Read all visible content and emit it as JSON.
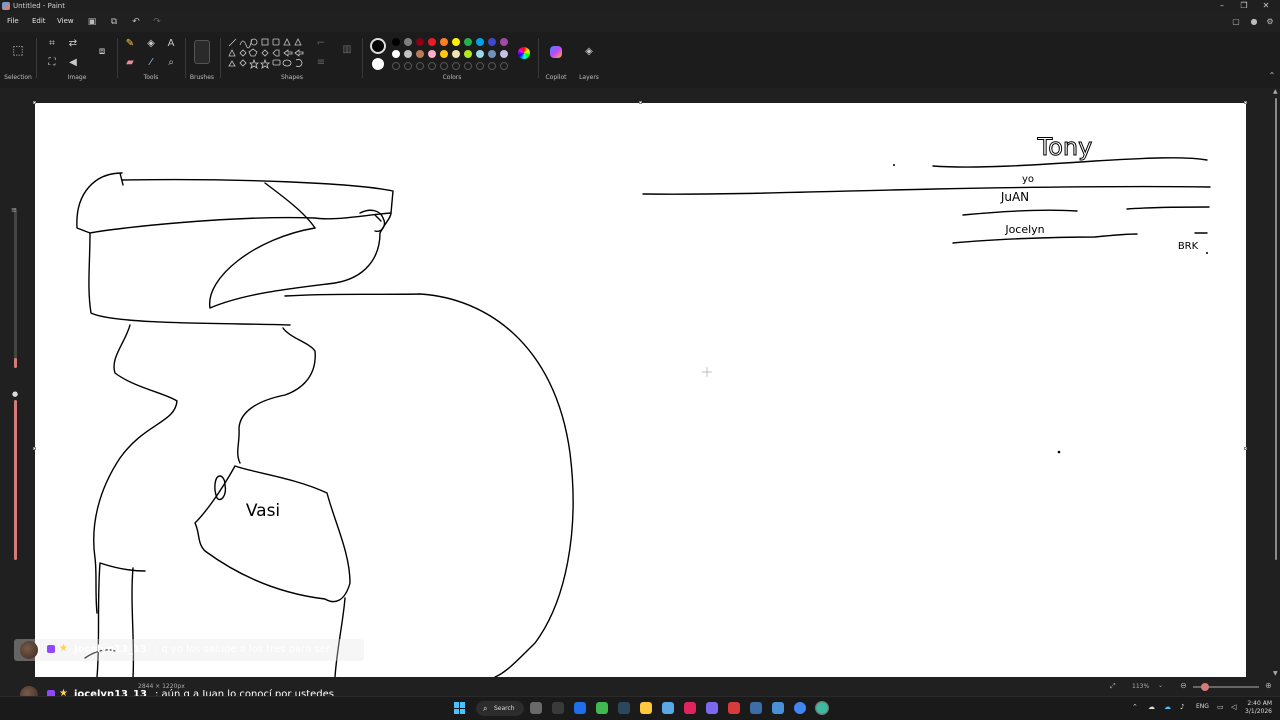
{
  "window": {
    "title": "Untitled - Paint"
  },
  "menu": {
    "file": "File",
    "edit": "Edit",
    "view": "View"
  },
  "ribbon": {
    "groups": {
      "selection": "Selection",
      "image": "Image",
      "tools": "Tools",
      "brushes": "Brushes",
      "shapes": "Shapes",
      "colors": "Colors",
      "copilot": "Copilot",
      "layers": "Layers"
    },
    "palette": [
      "#000000",
      "#7f7f7f",
      "#880015",
      "#ed1c24",
      "#ff7f27",
      "#fff200",
      "#22b14c",
      "#00a2e8",
      "#3f48cc",
      "#a349a4",
      "#ffffff",
      "#c3c3c3",
      "#b97a57",
      "#ffaec9",
      "#ffc90e",
      "#efe4b0",
      "#b5e61d",
      "#99d9ea",
      "#7092be",
      "#c8bfe7"
    ],
    "primary_color": "#000000",
    "secondary_color": "#ffffff"
  },
  "drawing": {
    "name_tony": "Tony",
    "name_yo": "yo",
    "name_juan": "JuAN",
    "name_jocelyn": "Jocelyn",
    "name_brk": "BRK",
    "mug_text": "Vasi"
  },
  "chat": [
    {
      "user": "jocelyn13_13",
      "message": ": q yo los salude a los tres para ser amistad"
    },
    {
      "user": "jocelyn13_13",
      "message": ": aún q a Juan lo conocí por ustedes"
    }
  ],
  "status": {
    "canvas_size": "2844 × 1220px",
    "zoom": "113%"
  },
  "taskbar": {
    "search": "Search",
    "lang": "ENG",
    "time": "2:40 AM",
    "date": "3/1/2026"
  }
}
